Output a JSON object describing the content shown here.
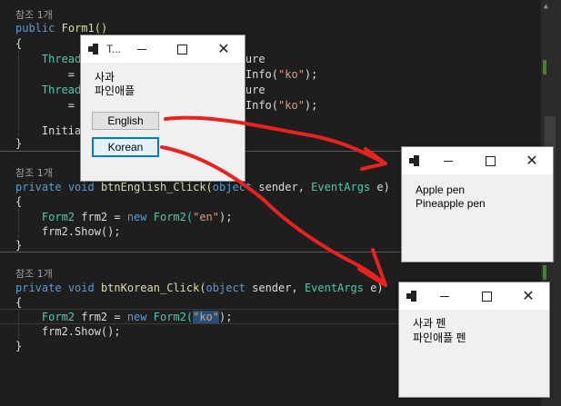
{
  "code": {
    "ref1": "참조 1개",
    "l_public": "public",
    "l_form1": "Form1()",
    "brace_open": "{",
    "brace_close": "}",
    "thread1": "Thread",
    "thread1_tail": "ulture",
    "eq1": "=",
    "ci1_tail": "ultureInfo(",
    "ko_str": "\"ko\"",
    "close_semi": ");",
    "thread2": "Thread",
    "thread2_tail": "ulture",
    "eq2": "=",
    "initial": "Initia",
    "ref2": "참조 1개",
    "kw_private": "private",
    "kw_void": "void",
    "m_english": "btnEnglish_Click(",
    "kw_object": "object",
    "sender": " sender, ",
    "ty_eventargs": "EventArgs",
    "e_close": " e)",
    "ty_form2": "Form2",
    "frm2_new": " frm2 = ",
    "kw_new": "new",
    "form2_call": "Form2(",
    "en_str": "\"en\"",
    "show": "frm2.Show();",
    "ref3": "참조 1개",
    "m_korean": "btnKorean_Click(",
    "ko_str2": "\"ko\""
  },
  "form1": {
    "title": "T...",
    "label1": "사과",
    "label2": "파인애플",
    "btn_english": "English",
    "btn_korean": "Korean"
  },
  "form_en": {
    "line1": "Apple pen",
    "line2": "Pineapple pen"
  },
  "form_ko": {
    "line1": "사과 펜",
    "line2": "파인애플 펜"
  },
  "captions": {
    "min": "",
    "max": "",
    "close": "✕"
  },
  "colors": {
    "arrow": "#e8231f",
    "focus": "#0078d7",
    "editor_bg": "#1e1e1e"
  }
}
